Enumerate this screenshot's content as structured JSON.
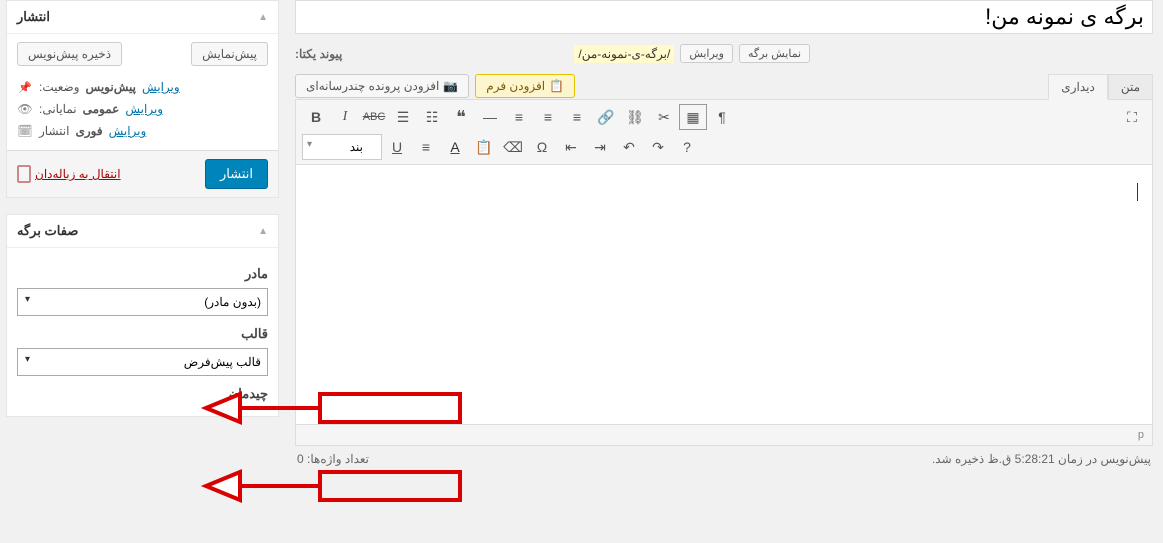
{
  "title_value": "برگه ی نمونه من!",
  "permalink": {
    "label": "پیوند یکتا:",
    "slug": "/برگه-ی-نمونه-من/",
    "edit_btn": "ویرایش",
    "view_btn": "نمایش برگه"
  },
  "media_btn": "افزودن پرونده چندرسانه‌ای",
  "form_btn": "افزودن فرم",
  "tabs": {
    "visual": "دیداری",
    "text": "متن"
  },
  "format_dropdown": "بند",
  "editor_footer_path": "p",
  "bottom": {
    "word_count": "تعداد واژه‌ها: 0",
    "save_note": "پیش‌نویس در زمان 5:28:21 ق.ظ ذخیره شد."
  },
  "publish_box": {
    "title": "انتشار",
    "save_draft": "ذخیره پیش‌نویس",
    "preview": "پیش‌نمایش",
    "status_label": "وضعیت:",
    "status_value": "پیش‌نویس",
    "visibility_label": "نمایانی:",
    "visibility_value": "عمومی",
    "publish_label": "انتشار",
    "publish_value": "فوری",
    "edit": "ویرایش",
    "trash": "انتقال به زباله‌دان",
    "publish_btn": "انتشار"
  },
  "attrs_box": {
    "title": "صفات برگه",
    "parent_label": "مادر",
    "parent_value": "(بدون مادر)",
    "template_label": "قالب",
    "template_value": "قالب پیش‌فرض",
    "order_label": "چیدمان"
  },
  "toolbar_icons_row1": [
    "B",
    "I",
    "ABC",
    "≣",
    "≣",
    "❝",
    "—",
    "≡",
    "≡",
    "≡",
    "🔗",
    "⛓",
    "✂",
    "▦",
    "¶"
  ],
  "toolbar_icons_row2": [
    "U",
    "≡",
    "A",
    "📋",
    "⌫",
    "Ω",
    "↔",
    "↔",
    "↶",
    "↷",
    "?"
  ]
}
